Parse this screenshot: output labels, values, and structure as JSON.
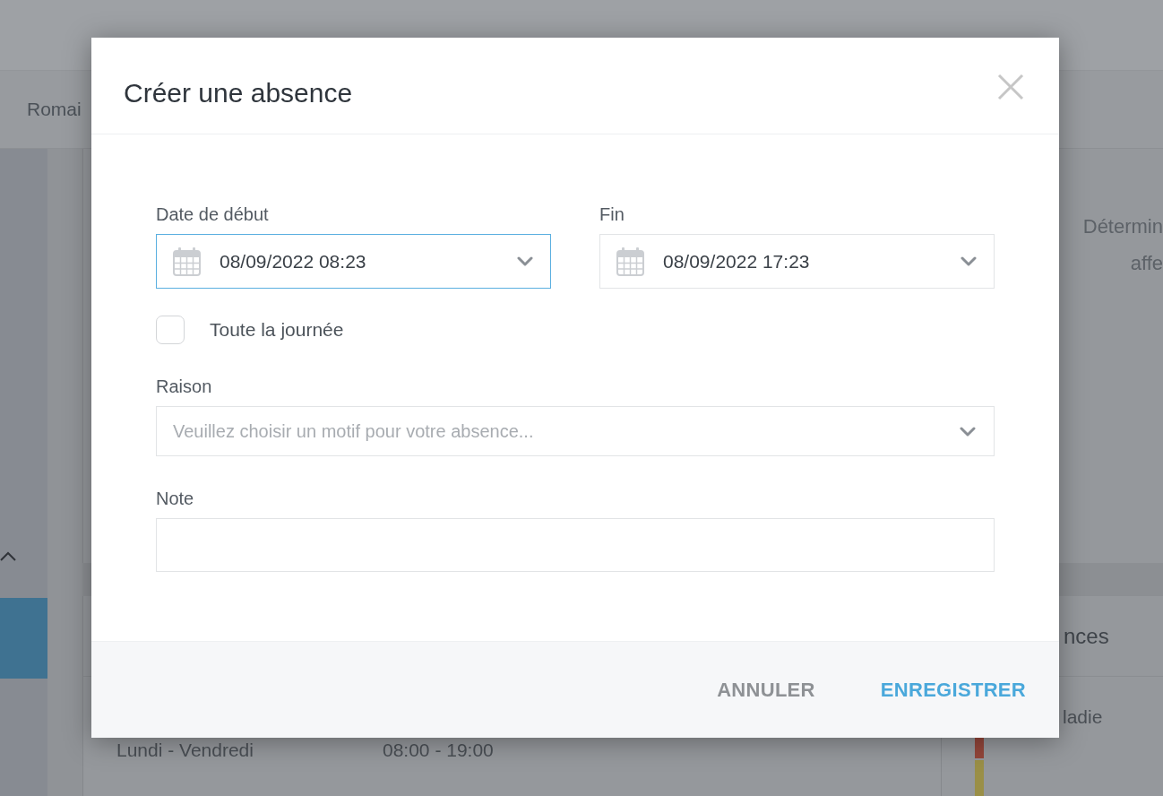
{
  "page": {
    "breadcrumb": "Romai",
    "description_lines": [
      "Détermin",
      "affe"
    ],
    "schedule": {
      "days": "Lundi - Vendredi",
      "hours": "08:00 - 19:00"
    },
    "side_panel": {
      "title": "nces",
      "items": [
        {
          "label": "ladie",
          "color": "#94463a"
        },
        {
          "color": "#9a8f47"
        }
      ]
    }
  },
  "dialog": {
    "title": "Créer une absence",
    "start": {
      "label": "Date de début",
      "value": "08/09/2022 08:23",
      "focused": true
    },
    "end": {
      "label": "Fin",
      "value": "08/09/2022 17:23",
      "focused": false
    },
    "all_day": {
      "label": "Toute la journée",
      "checked": false
    },
    "reason": {
      "label": "Raison",
      "placeholder": "Veuillez choisir un motif pour votre absence..."
    },
    "note": {
      "label": "Note"
    },
    "buttons": [
      {
        "label": "ANNULER",
        "kind": "secondary"
      },
      {
        "label": "ENREGISTRER",
        "kind": "primary"
      }
    ]
  }
}
